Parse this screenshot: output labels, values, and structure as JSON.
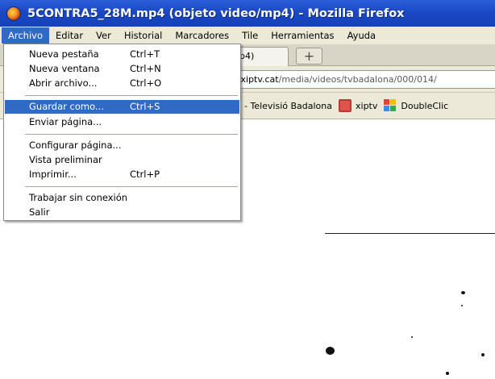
{
  "window": {
    "title": "5CONTRA5_28M.mp4 (objeto video/mp4) - Mozilla Firefox"
  },
  "menubar": {
    "items": [
      "Archivo",
      "Editar",
      "Ver",
      "Historial",
      "Marcadores",
      "Tile",
      "Herramientas",
      "Ayuda"
    ]
  },
  "tab": {
    "title": "p4)",
    "new_tab": "+"
  },
  "address": {
    "host": ".xiptv.cat",
    "path": "/media/videos/tvbadalona/000/014/"
  },
  "bookmarks": {
    "items": [
      "- Televisió Badalona",
      "xiptv",
      "DoubleClic"
    ]
  },
  "file_menu": {
    "new_tab": {
      "label": "Nueva pestaña",
      "shortcut": "Ctrl+T"
    },
    "new_window": {
      "label": "Nueva ventana",
      "shortcut": "Ctrl+N"
    },
    "open_file": {
      "label": "Abrir archivo...",
      "shortcut": "Ctrl+O"
    },
    "save_as": {
      "label": "Guardar como...",
      "shortcut": "Ctrl+S"
    },
    "send_page": {
      "label": "Enviar página..."
    },
    "page_setup": {
      "label": "Configurar página..."
    },
    "print_preview": {
      "label": "Vista preliminar"
    },
    "print": {
      "label": "Imprimir...",
      "shortcut": "Ctrl+P"
    },
    "work_offline": {
      "label": "Trabajar sin conexión"
    },
    "exit": {
      "label": "Salir"
    }
  }
}
